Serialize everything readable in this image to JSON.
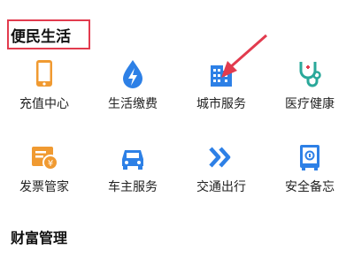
{
  "section": {
    "title": "便民生活"
  },
  "items": [
    {
      "label": "充值中心",
      "icon": "phone-icon"
    },
    {
      "label": "生活缴费",
      "icon": "water-bolt-icon"
    },
    {
      "label": "城市服务",
      "icon": "city-building-icon"
    },
    {
      "label": "医疗健康",
      "icon": "stethoscope-icon"
    },
    {
      "label": "发票管家",
      "icon": "invoice-icon"
    },
    {
      "label": "车主服务",
      "icon": "car-icon"
    },
    {
      "label": "交通出行",
      "icon": "forward-arrows-icon"
    },
    {
      "label": "安全备忘",
      "icon": "safe-icon"
    }
  ],
  "finance": {
    "title": "财富管理"
  },
  "colors": {
    "orange": "#f09a31",
    "blue": "#2d80e6",
    "teal": "#2aa89a",
    "annotation_red": "#e23b4e"
  }
}
